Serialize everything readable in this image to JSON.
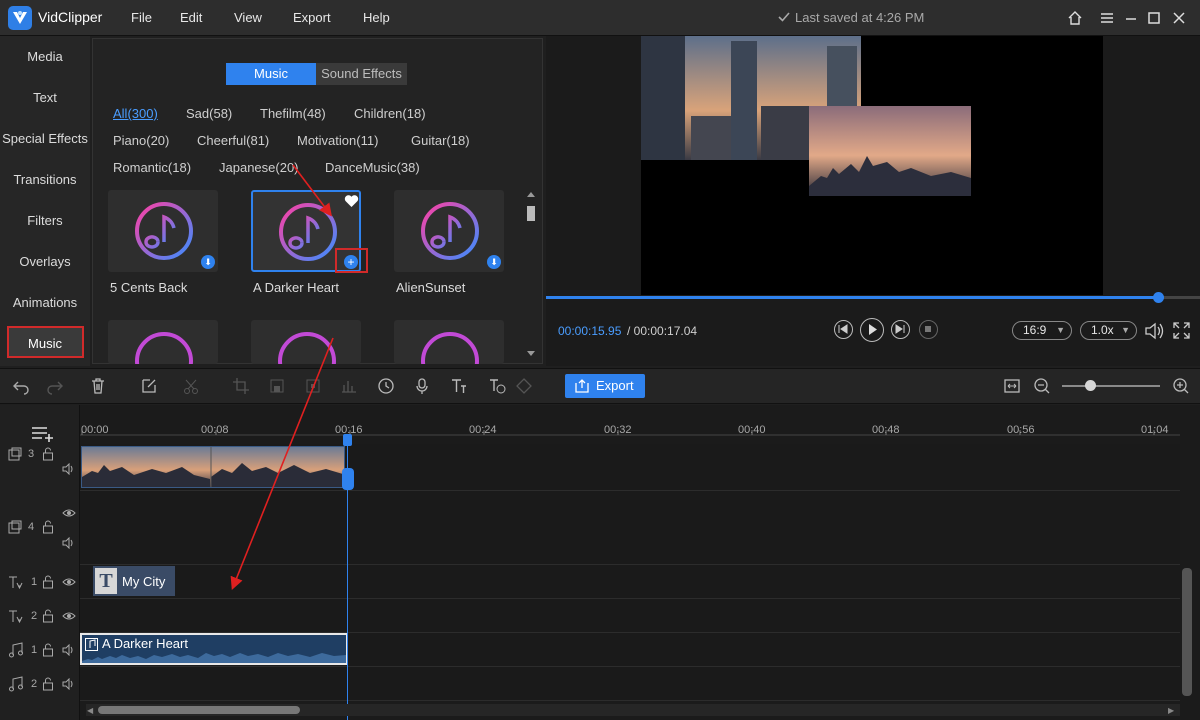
{
  "app": {
    "name": "VidClipper",
    "menu": [
      "File",
      "Edit",
      "View",
      "Export",
      "Help"
    ],
    "saved_status": "Last saved at 4:26 PM"
  },
  "sidebar": {
    "items": [
      {
        "label": "Media"
      },
      {
        "label": "Text"
      },
      {
        "label": "Special Effects"
      },
      {
        "label": "Transitions"
      },
      {
        "label": "Filters"
      },
      {
        "label": "Overlays"
      },
      {
        "label": "Animations"
      },
      {
        "label": "Music",
        "selected": true
      }
    ]
  },
  "library": {
    "tabs": [
      {
        "label": "Music",
        "active": true
      },
      {
        "label": "Sound Effects",
        "active": false
      }
    ],
    "categories": [
      {
        "label": "All(300)",
        "active": true
      },
      {
        "label": "Sad(58)"
      },
      {
        "label": "Thefilm(48)"
      },
      {
        "label": "Children(18)"
      },
      {
        "label": "Piano(20)"
      },
      {
        "label": "Cheerful(81)"
      },
      {
        "label": "Motivation(11)"
      },
      {
        "label": "Guitar(18)"
      },
      {
        "label": "Romantic(18)"
      },
      {
        "label": "Japanese(20)"
      },
      {
        "label": "DanceMusic(38)"
      }
    ],
    "items": [
      {
        "title": "5 Cents Back",
        "badge": "download"
      },
      {
        "title": "A Darker Heart",
        "badge": "add",
        "selected": true,
        "favorite": true
      },
      {
        "title": "AlienSunset",
        "badge": "download"
      }
    ]
  },
  "preview": {
    "current_time": "00:00:15.95",
    "total_time": "/ 00:00:17.04",
    "progress": 0.936,
    "aspect_ratio": "16:9",
    "speed": "1.0x"
  },
  "toolbar": {
    "export_label": "Export",
    "zoom_level": 0.28
  },
  "timeline": {
    "ruler": [
      "00:00",
      "00:08",
      "00:16",
      "00:24",
      "00:32",
      "00:40",
      "00:48",
      "00:56",
      "01:04"
    ],
    "tracks": [
      {
        "type": "video",
        "number": "3"
      },
      {
        "type": "video",
        "number": "4"
      },
      {
        "type": "text",
        "number": "1"
      },
      {
        "type": "text",
        "number": "2"
      },
      {
        "type": "audio",
        "number": "1"
      },
      {
        "type": "audio",
        "number": "2"
      }
    ],
    "title_clip": {
      "icon": "T",
      "text": "My City"
    },
    "audio_clip": {
      "text": "A Darker Heart"
    }
  },
  "colors": {
    "accent": "#2f82ee",
    "annotation": "#d12a2a",
    "background": "#1f1f1f"
  }
}
